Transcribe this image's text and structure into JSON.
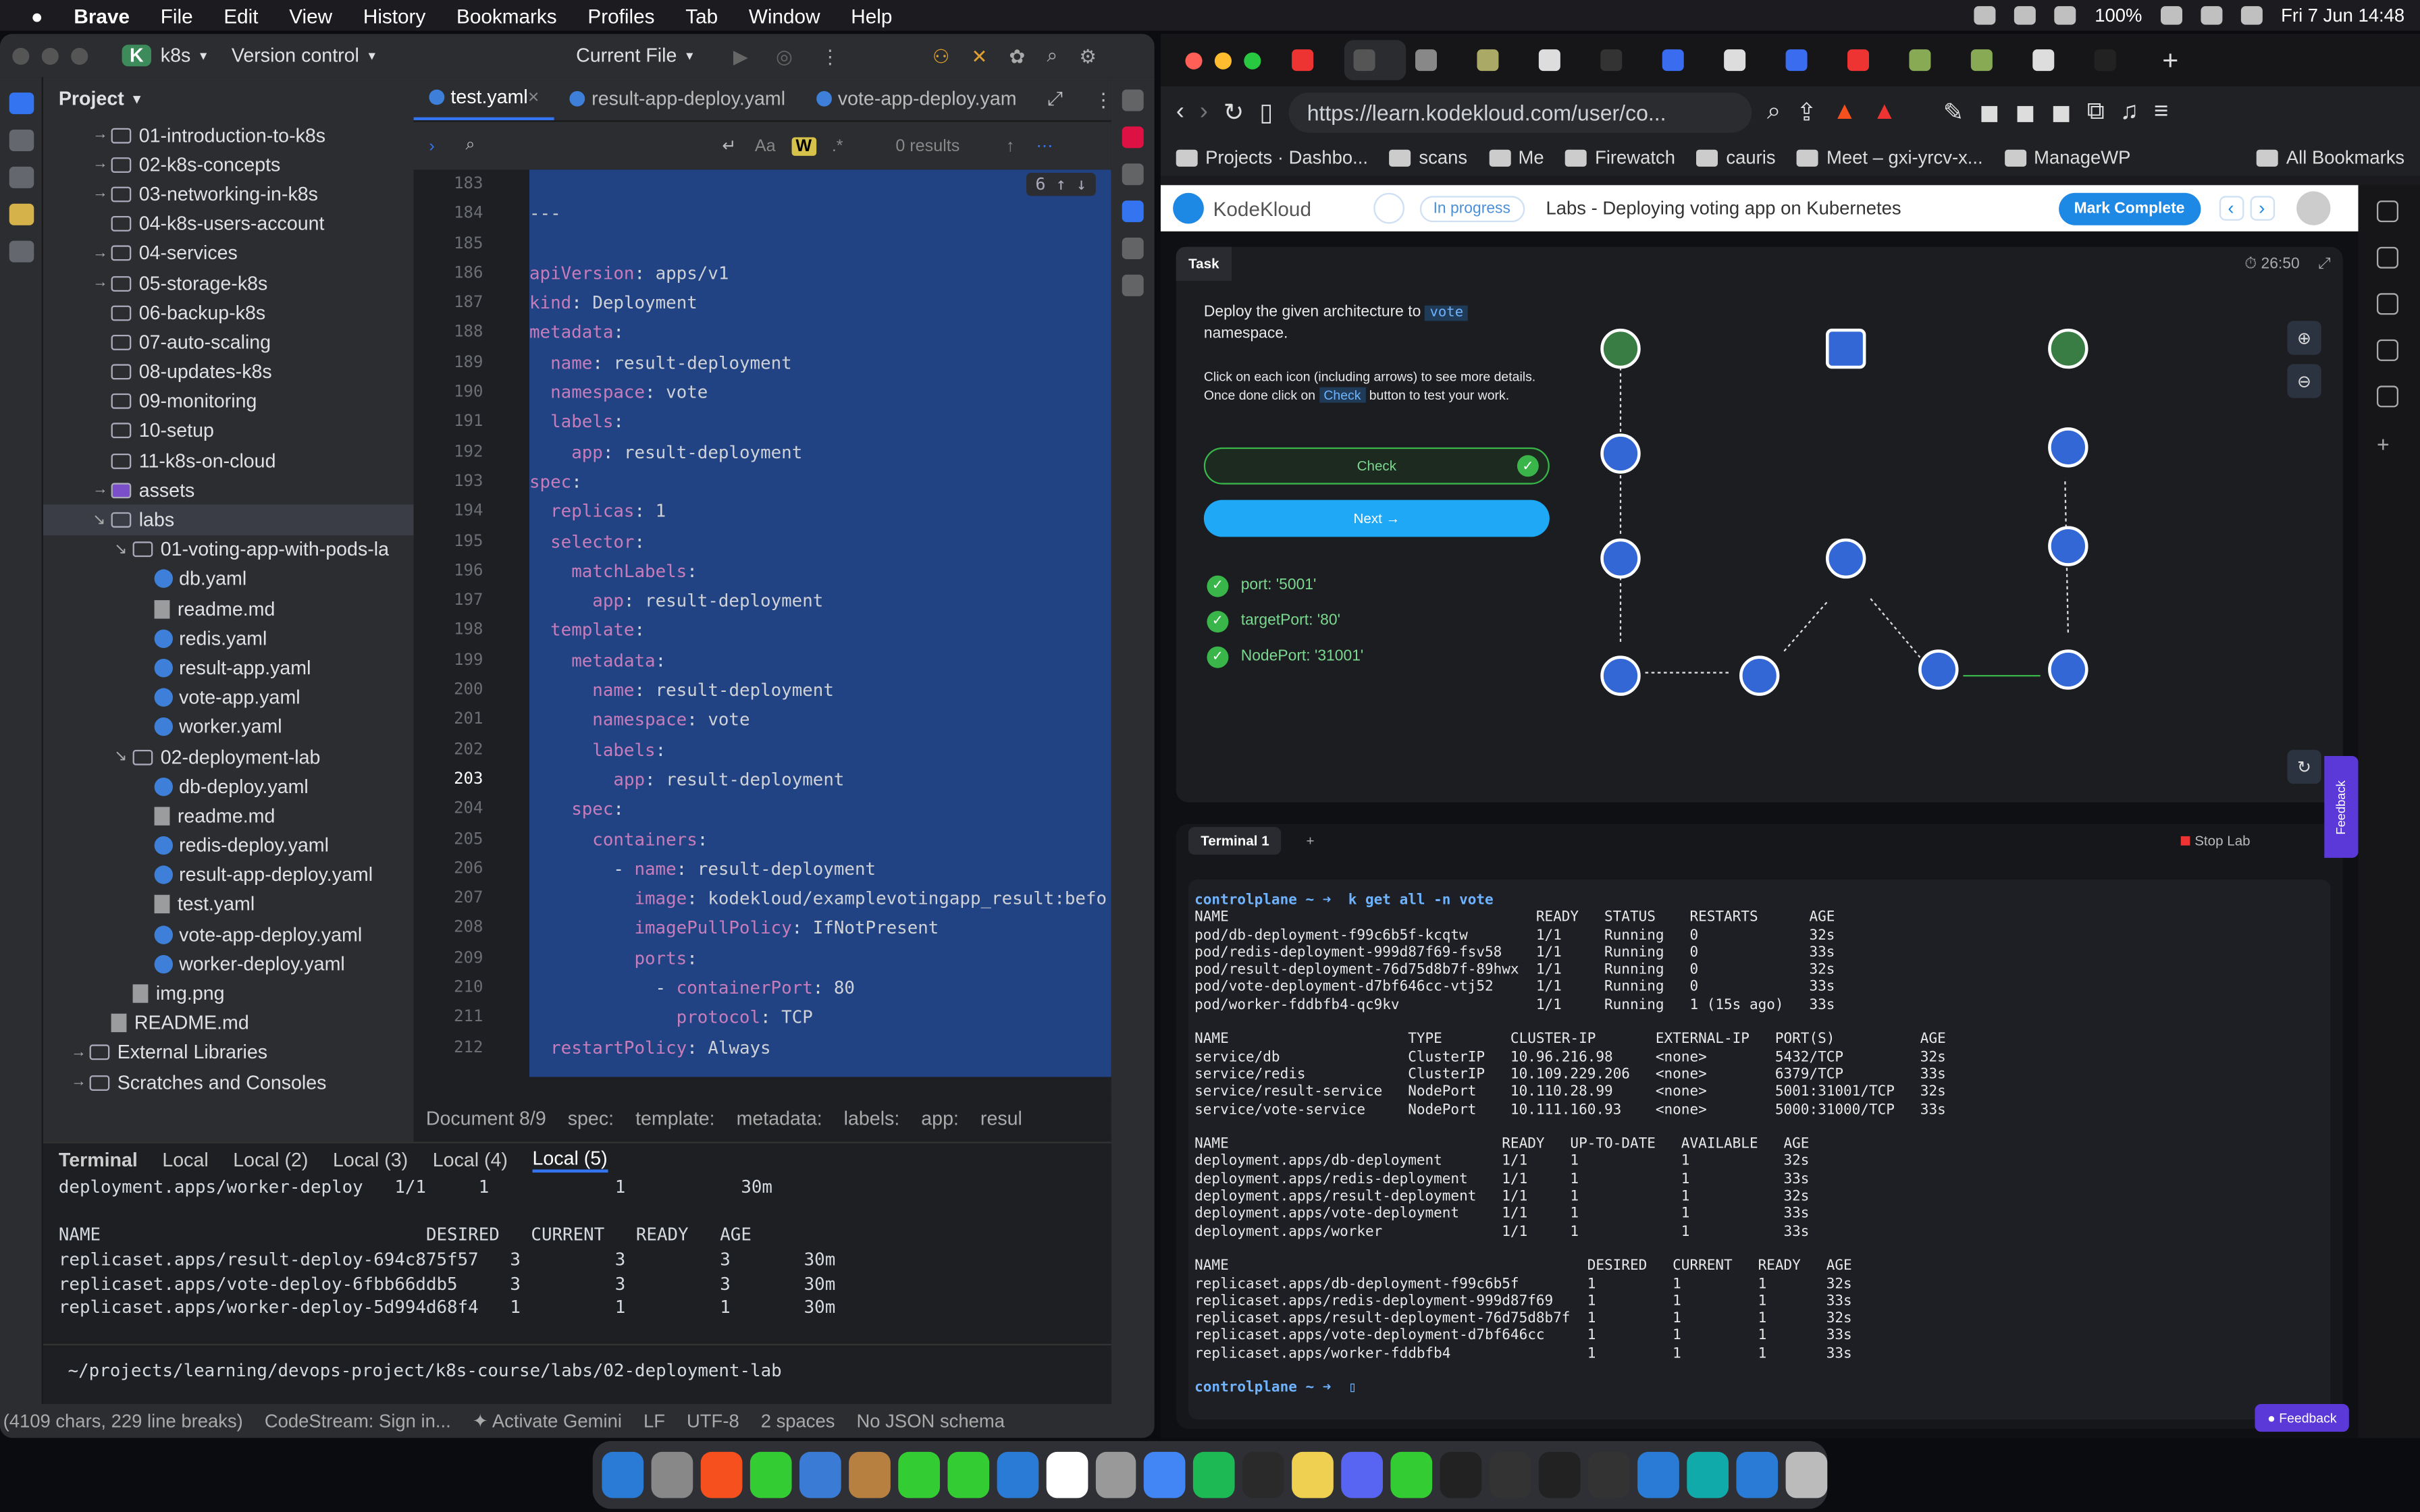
{
  "menubar": {
    "app": "Brave",
    "items": [
      "File",
      "Edit",
      "View",
      "History",
      "Bookmarks",
      "Profiles",
      "Tab",
      "Window",
      "Help"
    ],
    "battery": "100%",
    "datetime": "Fri 7 Jun  14:48"
  },
  "ide": {
    "project_badge": "K",
    "project": "k8s",
    "vcs": "Version control",
    "run_config": "Current File",
    "panel_title": "Project",
    "tree": [
      {
        "label": "01-introduction-to-k8s",
        "indent": 1,
        "type": "folder",
        "arrow": "→"
      },
      {
        "label": "02-k8s-concepts",
        "indent": 1,
        "type": "folder",
        "arrow": "→"
      },
      {
        "label": "03-networking-in-k8s",
        "indent": 1,
        "type": "folder",
        "arrow": "→"
      },
      {
        "label": "04-k8s-users-account",
        "indent": 1,
        "type": "folder",
        "arrow": ""
      },
      {
        "label": "04-services",
        "indent": 1,
        "type": "folder",
        "arrow": "→"
      },
      {
        "label": "05-storage-k8s",
        "indent": 1,
        "type": "folder",
        "arrow": "→"
      },
      {
        "label": "06-backup-k8s",
        "indent": 1,
        "type": "folder",
        "arrow": ""
      },
      {
        "label": "07-auto-scaling",
        "indent": 1,
        "type": "folder",
        "arrow": ""
      },
      {
        "label": "08-updates-k8s",
        "indent": 1,
        "type": "folder",
        "arrow": ""
      },
      {
        "label": "09-monitoring",
        "indent": 1,
        "type": "folder",
        "arrow": ""
      },
      {
        "label": "10-setup",
        "indent": 1,
        "type": "folder",
        "arrow": ""
      },
      {
        "label": "11-k8s-on-cloud",
        "indent": 1,
        "type": "folder",
        "arrow": ""
      },
      {
        "label": "assets",
        "indent": 1,
        "type": "folder",
        "arrow": "→"
      },
      {
        "label": "labs",
        "indent": 1,
        "type": "folder",
        "arrow": "↘",
        "sel": true
      },
      {
        "label": "01-voting-app-with-pods-la",
        "indent": 2,
        "type": "folder",
        "arrow": "↘"
      },
      {
        "label": "db.yaml",
        "indent": 3,
        "type": "yaml"
      },
      {
        "label": "readme.md",
        "indent": 3,
        "type": "md"
      },
      {
        "label": "redis.yaml",
        "indent": 3,
        "type": "yaml"
      },
      {
        "label": "result-app.yaml",
        "indent": 3,
        "type": "yaml"
      },
      {
        "label": "vote-app.yaml",
        "indent": 3,
        "type": "yaml"
      },
      {
        "label": "worker.yaml",
        "indent": 3,
        "type": "yaml"
      },
      {
        "label": "02-deployment-lab",
        "indent": 2,
        "type": "folder",
        "arrow": "↘"
      },
      {
        "label": "db-deploy.yaml",
        "indent": 3,
        "type": "yaml"
      },
      {
        "label": "readme.md",
        "indent": 3,
        "type": "md"
      },
      {
        "label": "redis-deploy.yaml",
        "indent": 3,
        "type": "yaml"
      },
      {
        "label": "result-app-deploy.yaml",
        "indent": 3,
        "type": "yaml"
      },
      {
        "label": "test.yaml",
        "indent": 3,
        "type": "md"
      },
      {
        "label": "vote-app-deploy.yaml",
        "indent": 3,
        "type": "yaml"
      },
      {
        "label": "worker-deploy.yaml",
        "indent": 3,
        "type": "yaml"
      },
      {
        "label": "img.png",
        "indent": 2,
        "type": "img"
      },
      {
        "label": "README.md",
        "indent": 1,
        "type": "md"
      },
      {
        "label": "External Libraries",
        "indent": 0,
        "type": "lib",
        "arrow": "→"
      },
      {
        "label": "Scratches and Consoles",
        "indent": 0,
        "type": "lib",
        "arrow": "→"
      }
    ],
    "tabs": [
      {
        "label": "test.yaml",
        "active": true
      },
      {
        "label": "result-app-deploy.yaml",
        "active": false
      },
      {
        "label": "vote-app-deploy.yam",
        "active": false
      }
    ],
    "find": {
      "results": "0 results",
      "match_count": "6"
    },
    "lines": [
      {
        "n": "183",
        "t": ""
      },
      {
        "n": "184",
        "t": "---"
      },
      {
        "n": "185",
        "t": ""
      },
      {
        "n": "186",
        "t": "apiVersion: apps/v1"
      },
      {
        "n": "187",
        "t": "kind: Deployment"
      },
      {
        "n": "188",
        "t": "metadata:"
      },
      {
        "n": "189",
        "t": "  name: result-deployment"
      },
      {
        "n": "190",
        "t": "  namespace: vote"
      },
      {
        "n": "191",
        "t": "  labels:"
      },
      {
        "n": "192",
        "t": "    app: result-deployment"
      },
      {
        "n": "193",
        "t": "spec:"
      },
      {
        "n": "194",
        "t": "  replicas: 1"
      },
      {
        "n": "195",
        "t": "  selector:"
      },
      {
        "n": "196",
        "t": "    matchLabels:"
      },
      {
        "n": "197",
        "t": "      app: result-deployment"
      },
      {
        "n": "198",
        "t": "  template:"
      },
      {
        "n": "199",
        "t": "    metadata:"
      },
      {
        "n": "200",
        "t": "      name: result-deployment"
      },
      {
        "n": "201",
        "t": "      namespace: vote"
      },
      {
        "n": "202",
        "t": "      labels:"
      },
      {
        "n": "203",
        "t": "        app: result-deployment"
      },
      {
        "n": "204",
        "t": "    spec:"
      },
      {
        "n": "205",
        "t": "      containers:"
      },
      {
        "n": "206",
        "t": "        - name: result-deployment"
      },
      {
        "n": "207",
        "t": "          image: kodekloud/examplevotingapp_result:befo"
      },
      {
        "n": "208",
        "t": "          imagePullPolicy: IfNotPresent"
      },
      {
        "n": "209",
        "t": "          ports:"
      },
      {
        "n": "210",
        "t": "            - containerPort: 80"
      },
      {
        "n": "211",
        "t": "              protocol: TCP"
      },
      {
        "n": "212",
        "t": "  restartPolicy: Always"
      }
    ],
    "breadcrumb": [
      "Document 8/9",
      "spec:",
      "template:",
      "metadata:",
      "labels:",
      "app:",
      "resul"
    ],
    "terminal_tabs": [
      "Terminal",
      "Local",
      "Local (2)",
      "Local (3)",
      "Local (4)",
      "Local (5)"
    ],
    "terminal_lines": [
      "deployment.apps/worker-deploy   1/1     1            1           30m",
      "",
      "NAME                               DESIRED   CURRENT   READY   AGE",
      "replicaset.apps/result-deploy-694c875f57   3         3         3       30m",
      "replicaset.apps/vote-deploy-6fbb66ddb5     3         3         3       30m",
      "replicaset.apps/worker-deploy-5d994d68f4   1         1         1       30m"
    ],
    "terminal_path": "~/projects/learning/devops-project/k8s-course/labs/02-deployment-lab",
    "status": [
      "(4109 chars, 229 line breaks)",
      "CodeStream: Sign in...",
      "✦ Activate Gemini",
      "LF",
      "UTF-8",
      "2 spaces",
      "No JSON schema"
    ]
  },
  "browser": {
    "url": "https://learn.kodekloud.com/user/co...",
    "bookmarks": [
      "Projects · Dashbo...",
      "scans",
      "Me",
      "Firewatch",
      "cauris",
      "Meet – gxi-yrcv-x...",
      "ManageWP"
    ],
    "all_bookmarks": "All Bookmarks",
    "kodekloud": {
      "brand": "KodeKloud",
      "status": "In progress",
      "title": "Labs - Deploying voting app on Kubernetes",
      "mark_complete": "Mark Complete",
      "task_tab": "Task",
      "timer": "26:50",
      "task_text_1": "Deploy the given architecture to",
      "task_ns": "vote",
      "task_text_2": "namespace.",
      "task_hint": "Click on each icon (including arrows) to see more details. Once done click on",
      "task_hint_btn": "Check",
      "task_hint_end": "button to test your work.",
      "check": "Check",
      "next": "Next →",
      "checks": [
        "port: '5001'",
        "targetPort: '80'",
        "NodePort: '31001'"
      ],
      "terminal_tab": "Terminal 1",
      "stop_lab": "Stop Lab",
      "feedback": "Feedback",
      "terminal_lines": [
        "controlplane ~ ➜  k get all -n vote",
        "NAME                                    READY   STATUS    RESTARTS      AGE",
        "pod/db-deployment-f99c6b5f-kcqtw        1/1     Running   0             32s",
        "pod/redis-deployment-999d87f69-fsv58    1/1     Running   0             33s",
        "pod/result-deployment-76d75d8b7f-89hwx  1/1     Running   0             32s",
        "pod/vote-deployment-d7bf646cc-vtj52     1/1     Running   0             33s",
        "pod/worker-fddbfb4-qc9kv                1/1     Running   1 (15s ago)   33s",
        "",
        "NAME                     TYPE        CLUSTER-IP       EXTERNAL-IP   PORT(S)          AGE",
        "service/db               ClusterIP   10.96.216.98     <none>        5432/TCP         32s",
        "service/redis            ClusterIP   10.109.229.206   <none>        6379/TCP         33s",
        "service/result-service   NodePort    10.110.28.99     <none>        5001:31001/TCP   32s",
        "service/vote-service     NodePort    10.111.160.93    <none>        5000:31000/TCP   33s",
        "",
        "NAME                                READY   UP-TO-DATE   AVAILABLE   AGE",
        "deployment.apps/db-deployment       1/1     1            1           32s",
        "deployment.apps/redis-deployment    1/1     1            1           33s",
        "deployment.apps/result-deployment   1/1     1            1           32s",
        "deployment.apps/vote-deployment     1/1     1            1           33s",
        "deployment.apps/worker              1/1     1            1           33s",
        "",
        "NAME                                          DESIRED   CURRENT   READY   AGE",
        "replicaset.apps/db-deployment-f99c6b5f        1         1         1       32s",
        "replicaset.apps/redis-deployment-999d87f69    1         1         1       33s",
        "replicaset.apps/result-deployment-76d75d8b7f  1         1         1       32s",
        "replicaset.apps/vote-deployment-d7bf646cc     1         1         1       33s",
        "replicaset.apps/worker-fddbfb4                1         1         1       33s",
        "",
        "controlplane ~ ➜  ▯"
      ]
    }
  },
  "colors": {
    "accent": "#3574f0",
    "selection": "#214283",
    "kk_blue": "#1e88e5",
    "check_green": "#39b54a"
  }
}
